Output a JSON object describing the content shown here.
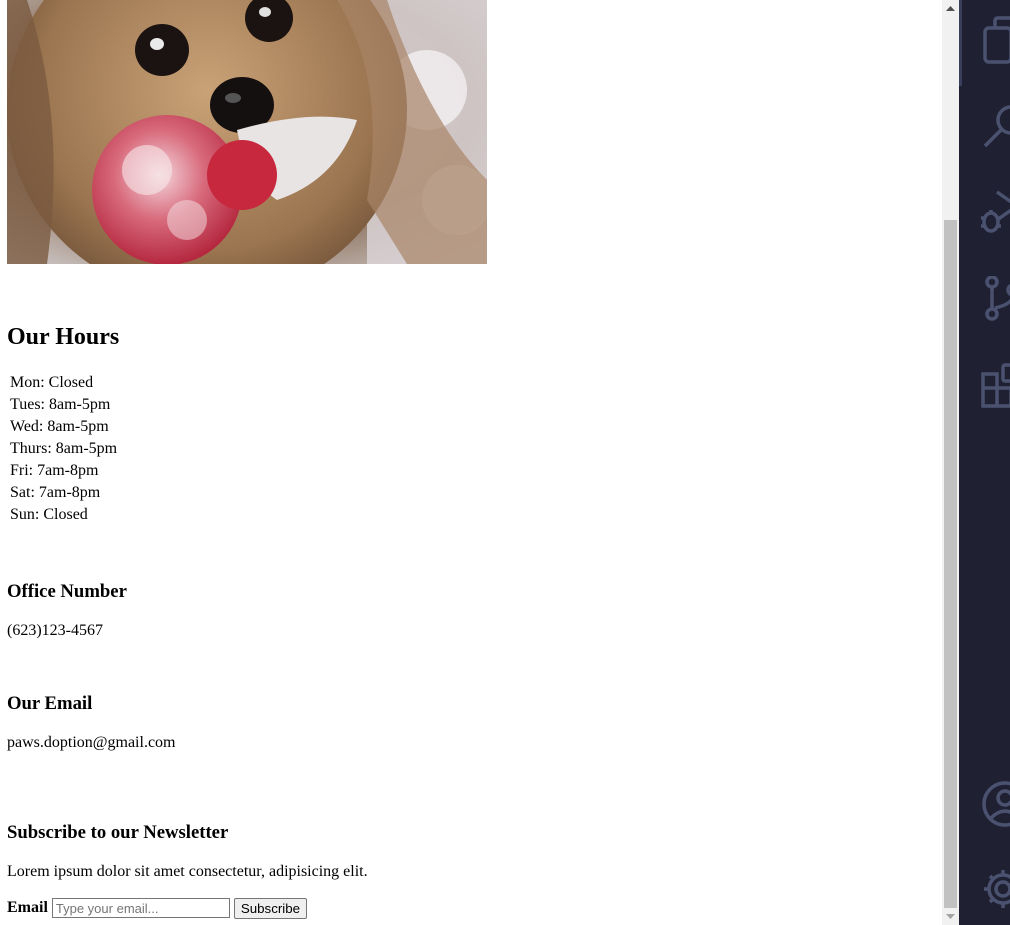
{
  "hours": {
    "title": "Our Hours",
    "items": [
      "Mon: Closed",
      "Tues: 8am-5pm",
      "Wed: 8am-5pm",
      "Thurs: 8am-5pm",
      "Fri: 7am-8pm",
      "Sat: 7am-8pm",
      "Sun: Closed"
    ]
  },
  "office": {
    "title": "Office Number",
    "value": "(623)123-4567"
  },
  "email_section": {
    "title": "Our Email",
    "value": "paws.doption@gmail.com"
  },
  "newsletter": {
    "title": "Subscribe to our Newsletter",
    "text": "Lorem ipsum dolor sit amet consectetur, adipisicing elit.",
    "label": "Email",
    "placeholder": "Type your email...",
    "button": "Subscribe"
  },
  "scrollbar": {
    "position_fraction": 0.24
  },
  "activity_bar": {
    "icons": [
      "files-icon",
      "search-icon",
      "debug-icon",
      "source-control-icon",
      "extensions-icon",
      "account-icon",
      "settings-gear-icon"
    ],
    "background": "#1f2133",
    "icon_color": "#4b5270"
  }
}
